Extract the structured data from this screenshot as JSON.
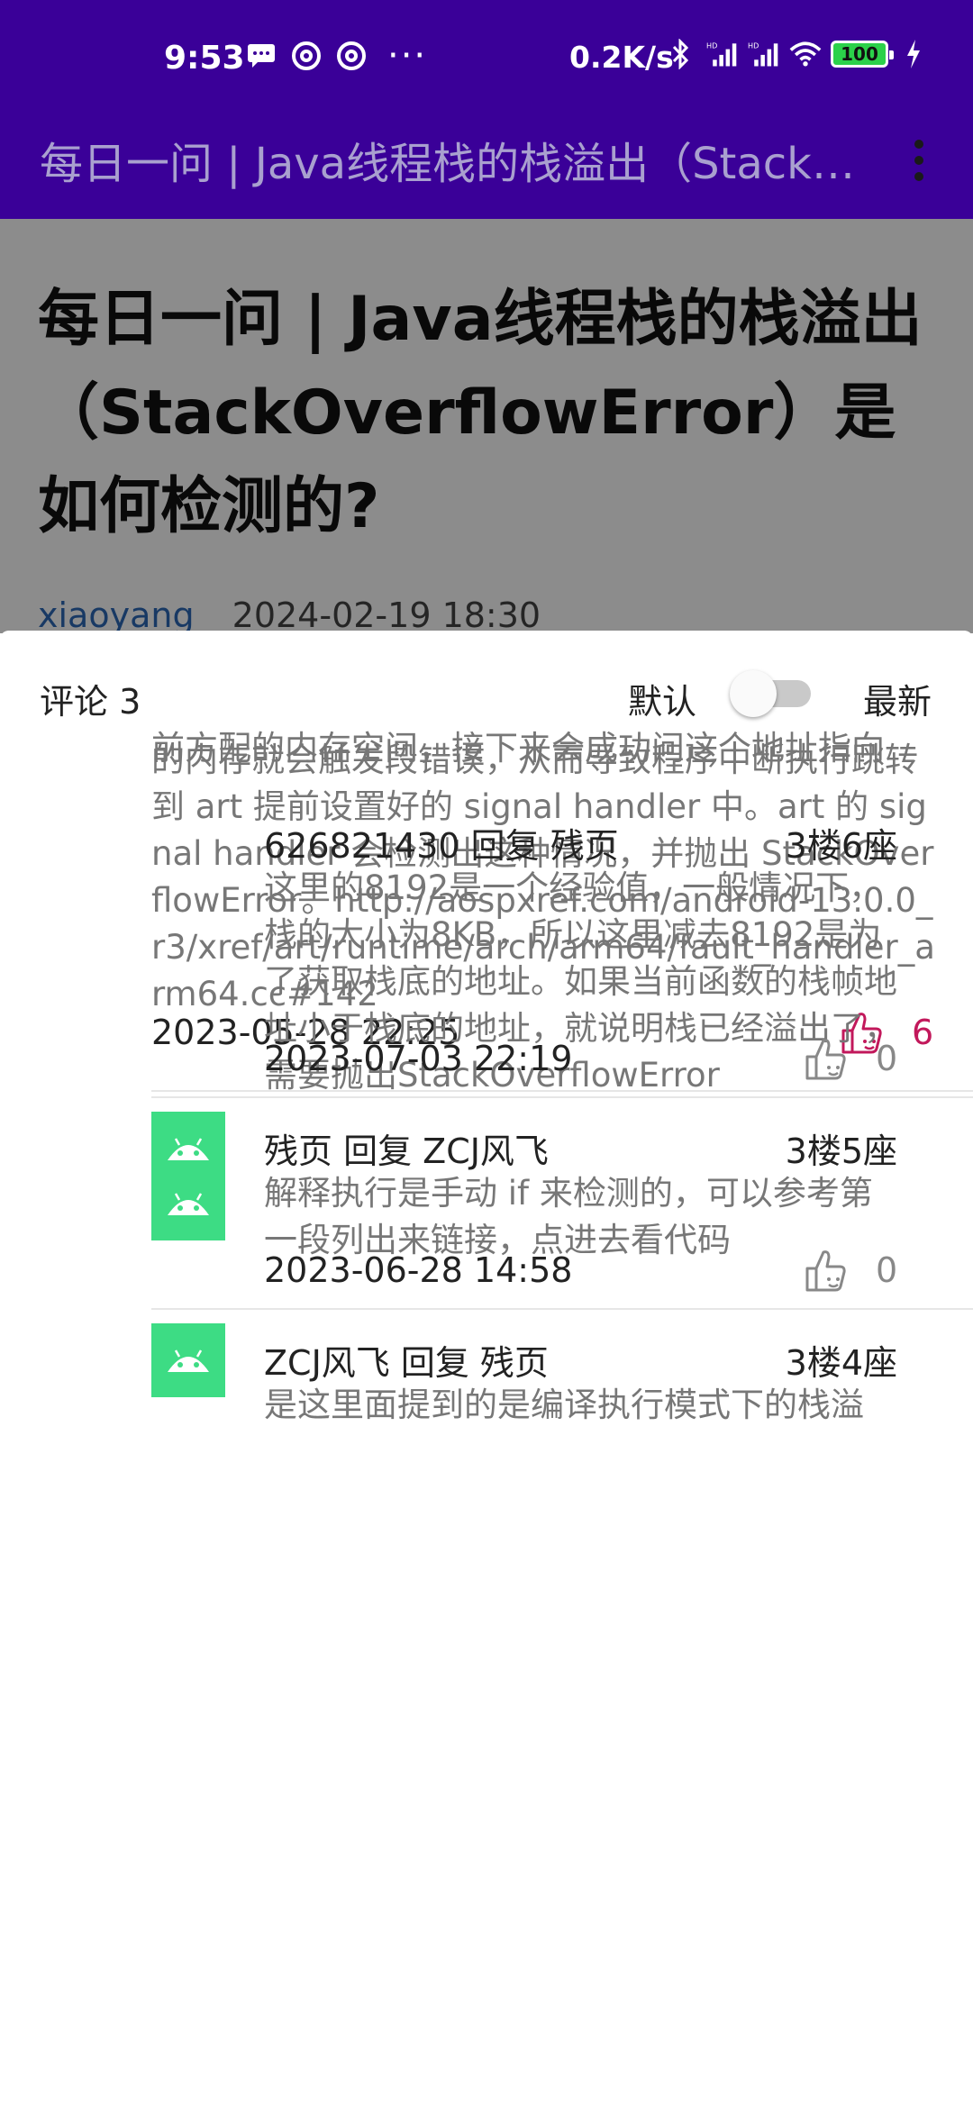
{
  "status_bar": {
    "time": "9:53",
    "speed": "0.2K/s",
    "battery": "100",
    "left_icons": [
      "message-icon",
      "at-icon",
      "at-icon",
      "more-dots-icon"
    ],
    "right_icons": [
      "bluetooth-icon",
      "signal-hd-icon",
      "signal-hd-icon",
      "wifi-icon",
      "battery-icon",
      "charging-icon"
    ]
  },
  "toolbar": {
    "title": "每日一问 | Java线程栈的栈溢出（StackOverflowError）是如何检测的？"
  },
  "article": {
    "title": "每日一问 | Java线程栈的栈溢出（StackOverflowError）是如何检测的?",
    "author": "xiaoyang",
    "date": "2024-02-19 18:30"
  },
  "comments": {
    "count_label": "评论 3",
    "sort_default": "默认",
    "sort_latest": "最新",
    "main": {
      "partial_top_line": "前方配的内存空间，接下来会成功问这个地址指向",
      "body": "的内存就会触发段错误，从而导致程序中断执行跳转到 art 提前设置好的 signal handler 中。art 的 signal handler 会检测出这种情况，并抛出 StackOverflowError。http://aospxref.com/android-13.0.0_r3/xref/art/runtime/arch/arm64/fault_handler_arm64.cc#142",
      "time": "2023-05-28 22:25",
      "likes": "6",
      "like_color": "#c2185b"
    },
    "replies": [
      {
        "header": "626821430 回复 残页",
        "floor": "3楼6座",
        "body": "这里的8192是一个经验值，一般情况下，栈的大小为8KB，所以这里减去8192是为了获取栈底的地址。如果当前函数的栈帧地址小于栈底的地址，就说明栈已经溢出了，需要抛出StackOverflowError",
        "time": "2023-07-03 22:19",
        "likes": "0"
      },
      {
        "header": "残页 回复 ZCJ风飞",
        "floor": "3楼5座",
        "body": "解释执行是手动 if 来检测的，可以参考第一段列出来链接，点进去看代码",
        "time": "2023-06-28 14:58",
        "likes": "0"
      },
      {
        "header": "ZCJ风飞 回复 残页",
        "floor": "3楼4座",
        "body": "是这里面提到的是编译执行模式下的栈溢",
        "time": "",
        "likes": ""
      }
    ]
  },
  "colors": {
    "app_bar": "#3a0098",
    "avatar": "#3ddc84",
    "author_link": "#2c69b7"
  }
}
